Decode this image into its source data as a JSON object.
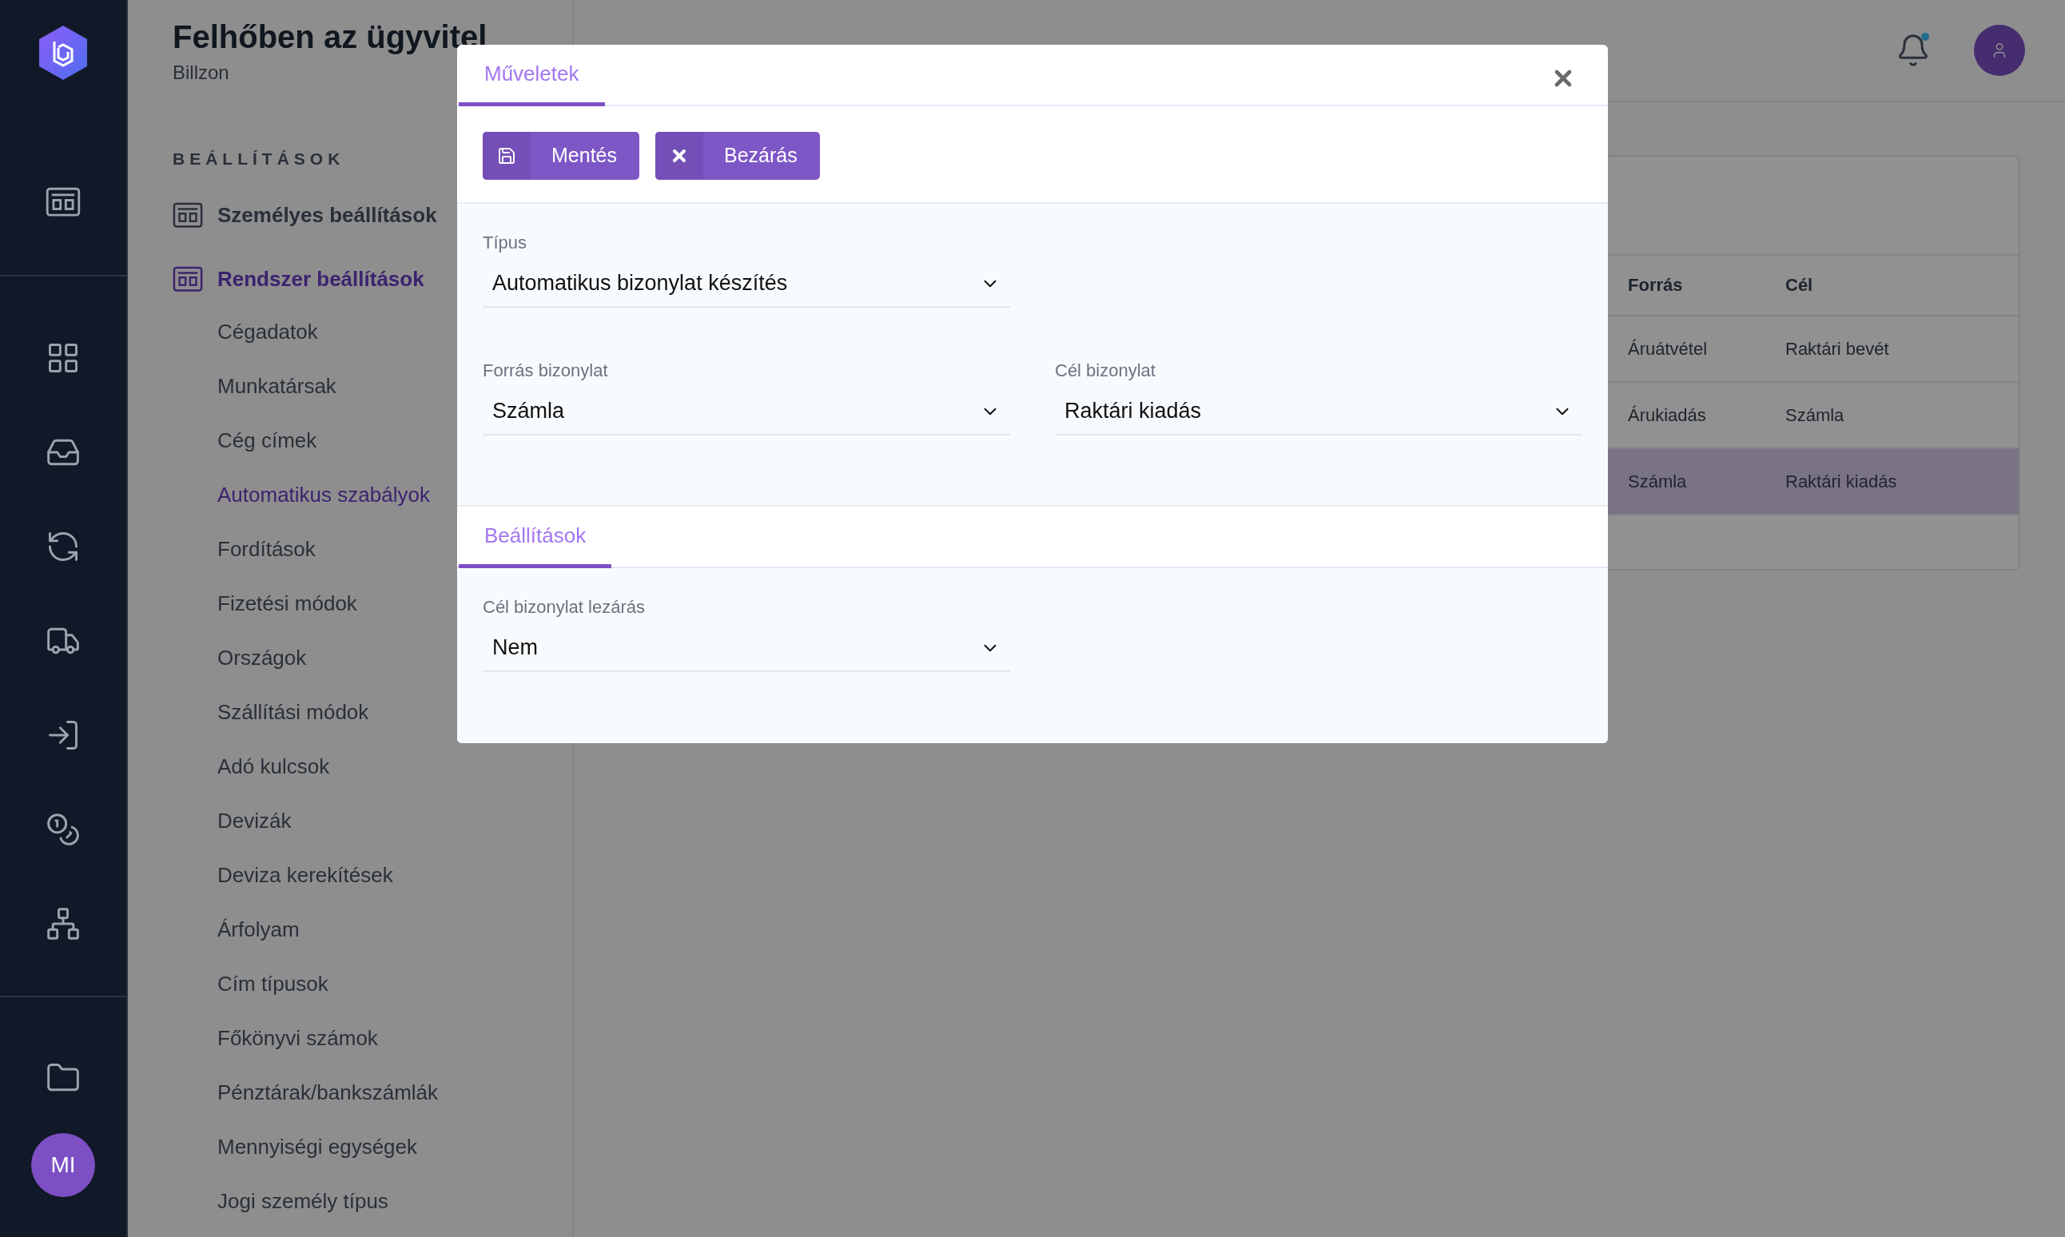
{
  "app": {
    "title": "Felhőben az ügyvitel",
    "subtitle": "Billzon"
  },
  "rail": {
    "top": [
      {
        "kind": "panel"
      }
    ],
    "middle": [
      {
        "kind": "grid"
      },
      {
        "kind": "inbox"
      },
      {
        "kind": "exchange"
      },
      {
        "kind": "truck"
      },
      {
        "kind": "import"
      },
      {
        "kind": "coins"
      },
      {
        "kind": "network"
      }
    ],
    "bottom": [
      {
        "kind": "folder"
      }
    ],
    "avatar": "MI"
  },
  "settings": {
    "heading": "BEÁLLÍTÁSOK",
    "groups": [
      {
        "label": "Személyes beállítások",
        "selected": false
      },
      {
        "label": "Rendszer beállítások",
        "selected": true,
        "children": [
          {
            "label": "Cégadatok",
            "selected": false
          },
          {
            "label": "Munkatársak",
            "selected": false
          },
          {
            "label": "Cég címek",
            "selected": false
          },
          {
            "label": "Automatikus szabályok",
            "selected": true
          },
          {
            "label": "Fordítások",
            "selected": false
          },
          {
            "label": "Fizetési módok",
            "selected": false
          },
          {
            "label": "Országok",
            "selected": false
          },
          {
            "label": "Szállítási módok",
            "selected": false
          },
          {
            "label": "Adó kulcsok",
            "selected": false
          },
          {
            "label": "Devizák",
            "selected": false
          },
          {
            "label": "Deviza kerekítések",
            "selected": false
          },
          {
            "label": "Árfolyam",
            "selected": false
          },
          {
            "label": "Cím típusok",
            "selected": false
          },
          {
            "label": "Főkönyvi számok",
            "selected": false
          },
          {
            "label": "Pénztárak/bankszámlák",
            "selected": false
          },
          {
            "label": "Mennyiségi egységek",
            "selected": false
          },
          {
            "label": "Jogi személy típus",
            "selected": false
          }
        ]
      }
    ]
  },
  "table": {
    "columns": [
      "Forrás",
      "Cél"
    ],
    "rows": [
      {
        "cells": [
          "Áruátvétel",
          "Raktári bevét"
        ],
        "selected": false
      },
      {
        "cells": [
          "Árukiadás",
          "Számla"
        ],
        "selected": false
      },
      {
        "cells": [
          "Számla",
          "Raktári kiadás"
        ],
        "selected": true
      }
    ]
  },
  "modal": {
    "tabs": [
      {
        "label": "Műveletek",
        "selected": true
      }
    ],
    "buttons": [
      {
        "kind": "save",
        "label": "Mentés"
      },
      {
        "kind": "close",
        "label": "Bezárás"
      }
    ],
    "field_rows": [
      [
        {
          "label": "Típus",
          "value": "Automatikus bizonylat készítés"
        }
      ],
      [
        {
          "label": "Forrás bizonylat",
          "value": "Számla"
        },
        {
          "label": "Cél bizonylat",
          "value": "Raktári kiadás"
        }
      ]
    ],
    "settings_tabs": [
      {
        "label": "Beállítások",
        "selected": true
      }
    ],
    "settings_rows": [
      [
        {
          "label": "Cél bizonylat lezárás",
          "value": "Nem"
        }
      ]
    ]
  }
}
